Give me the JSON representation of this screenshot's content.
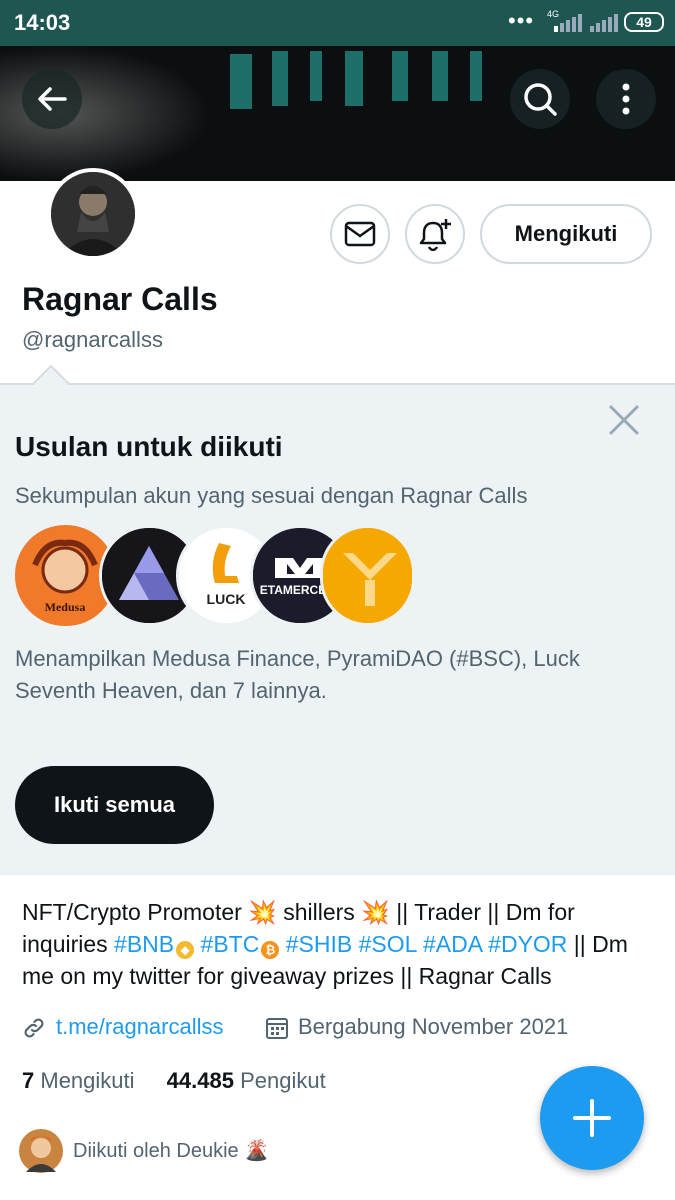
{
  "status_bar": {
    "time": "14:03",
    "network": "4G",
    "battery": "49"
  },
  "profile": {
    "display_name": "Ragnar Calls",
    "handle": "@ragnarcallss",
    "follow_button_label": "Mengikuti",
    "bio": {
      "segments": [
        {
          "text": "NFT/Crypto Promoter 💥 shillers 💥 || Trader || Dm for inquiries ",
          "type": "text"
        },
        {
          "text": "#BNB",
          "type": "tag"
        },
        {
          "text": " ",
          "type": "text",
          "badge": "bnb"
        },
        {
          "text": " ",
          "type": "text"
        },
        {
          "text": "#BTC",
          "type": "tag"
        },
        {
          "text": " ",
          "type": "text",
          "badge": "btc"
        },
        {
          "text": " ",
          "type": "text"
        },
        {
          "text": "#SHIB",
          "type": "tag"
        },
        {
          "text": " ",
          "type": "text"
        },
        {
          "text": "#SOL",
          "type": "tag"
        },
        {
          "text": " ",
          "type": "text"
        },
        {
          "text": "#ADA",
          "type": "tag"
        },
        {
          "text": " ",
          "type": "text"
        },
        {
          "text": "#DYOR",
          "type": "tag"
        },
        {
          "text": " || Dm me on my twitter for giveaway prizes || Ragnar Calls",
          "type": "text"
        }
      ]
    },
    "link": "t.me/ragnarcallss",
    "joined": "Bergabung November 2021",
    "following_count": "7",
    "following_label": "Mengikuti",
    "followers_count": "44.485",
    "followers_label": "Pengikut",
    "followed_by": "Diikuti oleh Deukie 🌋"
  },
  "suggestions": {
    "title": "Usulan untuk diikuti",
    "subtitle": "Sekumpulan akun yang sesuai dengan Ragnar Calls",
    "description": "Menampilkan Medusa Finance, PyramiDAO (#BSC), Luck Seventh Heaven, dan 7 lainnya.",
    "follow_all_label": "Ikuti semua",
    "avatars": [
      {
        "name": "Medusa",
        "label": "Medusa",
        "color": "#f0792a"
      },
      {
        "name": "PyramiDAO",
        "label": "",
        "color": "#15151a"
      },
      {
        "name": "Luck",
        "label": "LUCK",
        "color": "#ffffff"
      },
      {
        "name": "Metamerce",
        "label": "ETAMERCE",
        "color": "#1b1b2b"
      },
      {
        "name": "Yellow",
        "label": "",
        "color": "#f5a800"
      }
    ]
  },
  "colors": {
    "accent": "#1d9bf0",
    "status_bar": "#1e5652",
    "suggestion_bg": "#edf2f5"
  }
}
